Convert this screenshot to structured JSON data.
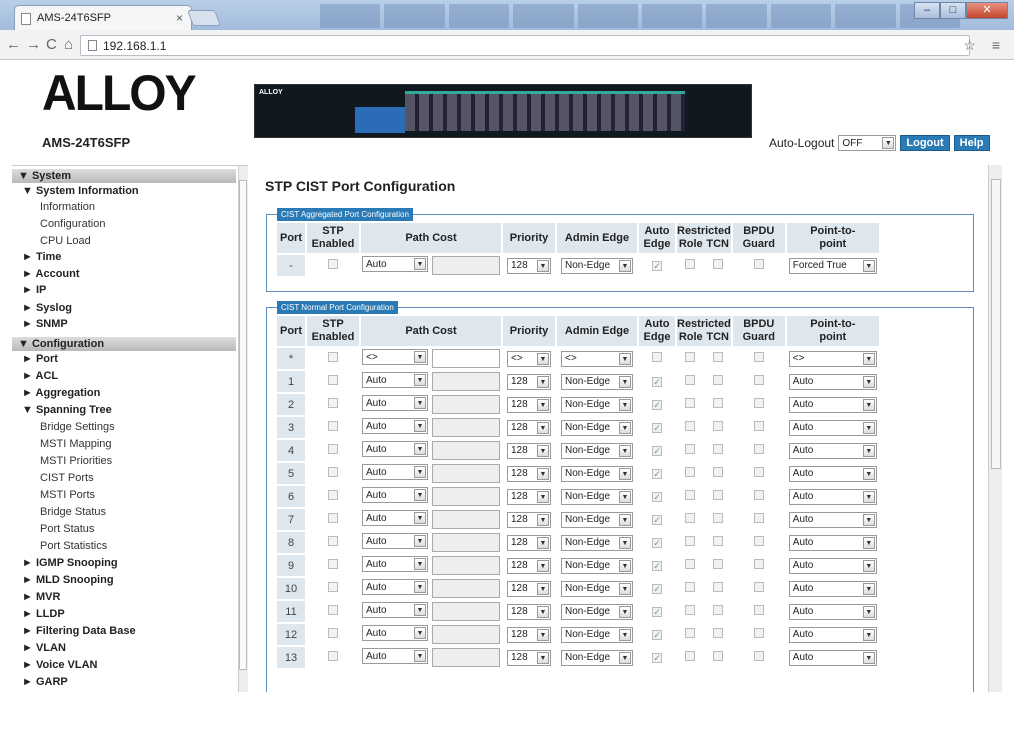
{
  "browser": {
    "tab_title": "AMS-24T6SFP",
    "url": "192.168.1.1"
  },
  "header": {
    "logo": "ALLOY",
    "model": "AMS-24T6SFP",
    "device_brand": "ALLOY",
    "auto_logout_label": "Auto-Logout",
    "auto_logout_value": "OFF",
    "logout_label": "Logout",
    "help_label": "Help"
  },
  "sidebar": [
    {
      "t": "▼ System",
      "lv": 0
    },
    {
      "t": "▼ System Information",
      "lv": 1
    },
    {
      "t": "Information",
      "lv": 2
    },
    {
      "t": "Configuration",
      "lv": 2
    },
    {
      "t": "CPU Load",
      "lv": 2
    },
    {
      "t": "► Time",
      "lv": 1
    },
    {
      "t": "► Account",
      "lv": 1
    },
    {
      "t": "► IP",
      "lv": 1
    },
    {
      "t": "► Syslog",
      "lv": 1
    },
    {
      "t": "► SNMP",
      "lv": 1
    },
    {
      "t": "▼ Configuration",
      "lv": 0
    },
    {
      "t": "► Port",
      "lv": 1
    },
    {
      "t": "► ACL",
      "lv": 1
    },
    {
      "t": "► Aggregation",
      "lv": 1
    },
    {
      "t": "▼ Spanning Tree",
      "lv": 1
    },
    {
      "t": "Bridge Settings",
      "lv": 2
    },
    {
      "t": "MSTI Mapping",
      "lv": 2
    },
    {
      "t": "MSTI Priorities",
      "lv": 2
    },
    {
      "t": "CIST Ports",
      "lv": 2
    },
    {
      "t": "MSTI Ports",
      "lv": 2
    },
    {
      "t": "Bridge Status",
      "lv": 2
    },
    {
      "t": "Port Status",
      "lv": 2
    },
    {
      "t": "Port Statistics",
      "lv": 2
    },
    {
      "t": "► IGMP Snooping",
      "lv": 1
    },
    {
      "t": "► MLD Snooping",
      "lv": 1
    },
    {
      "t": "► MVR",
      "lv": 1
    },
    {
      "t": "► LLDP",
      "lv": 1
    },
    {
      "t": "► Filtering Data Base",
      "lv": 1
    },
    {
      "t": "► VLAN",
      "lv": 1
    },
    {
      "t": "► Voice VLAN",
      "lv": 1
    },
    {
      "t": "► GARP",
      "lv": 1
    }
  ],
  "main": {
    "title": "STP CIST Port Configuration",
    "agg_legend": "CIST Aggregated Port Configuration",
    "normal_legend": "CIST Normal Port Configuration",
    "headers": {
      "port": "Port",
      "stp1": "STP",
      "stp2": "Enabled",
      "path_cost": "Path Cost",
      "priority": "Priority",
      "admin_edge": "Admin Edge",
      "auto1": "Auto",
      "auto2": "Edge",
      "restricted": "Restricted",
      "role": "Role",
      "tcn": "TCN",
      "bpdu1": "BPDU",
      "bpdu2": "Guard",
      "p2p1": "Point-to-",
      "p2p2": "point"
    },
    "agg_row": {
      "port": "-",
      "path_cost": "Auto",
      "priority": "128",
      "admin_edge": "Non-Edge",
      "auto_edge": true,
      "p2p": "Forced True"
    },
    "wildcard_row": {
      "port": "*",
      "path_cost": "<>",
      "priority": "<>",
      "admin_edge": "<>",
      "p2p": "<>"
    },
    "rows": [
      {
        "port": "1",
        "path_cost": "Auto",
        "priority": "128",
        "admin_edge": "Non-Edge",
        "auto_edge": true,
        "p2p": "Auto"
      },
      {
        "port": "2",
        "path_cost": "Auto",
        "priority": "128",
        "admin_edge": "Non-Edge",
        "auto_edge": true,
        "p2p": "Auto"
      },
      {
        "port": "3",
        "path_cost": "Auto",
        "priority": "128",
        "admin_edge": "Non-Edge",
        "auto_edge": true,
        "p2p": "Auto"
      },
      {
        "port": "4",
        "path_cost": "Auto",
        "priority": "128",
        "admin_edge": "Non-Edge",
        "auto_edge": true,
        "p2p": "Auto"
      },
      {
        "port": "5",
        "path_cost": "Auto",
        "priority": "128",
        "admin_edge": "Non-Edge",
        "auto_edge": true,
        "p2p": "Auto"
      },
      {
        "port": "6",
        "path_cost": "Auto",
        "priority": "128",
        "admin_edge": "Non-Edge",
        "auto_edge": true,
        "p2p": "Auto"
      },
      {
        "port": "7",
        "path_cost": "Auto",
        "priority": "128",
        "admin_edge": "Non-Edge",
        "auto_edge": true,
        "p2p": "Auto"
      },
      {
        "port": "8",
        "path_cost": "Auto",
        "priority": "128",
        "admin_edge": "Non-Edge",
        "auto_edge": true,
        "p2p": "Auto"
      },
      {
        "port": "9",
        "path_cost": "Auto",
        "priority": "128",
        "admin_edge": "Non-Edge",
        "auto_edge": true,
        "p2p": "Auto"
      },
      {
        "port": "10",
        "path_cost": "Auto",
        "priority": "128",
        "admin_edge": "Non-Edge",
        "auto_edge": true,
        "p2p": "Auto"
      },
      {
        "port": "11",
        "path_cost": "Auto",
        "priority": "128",
        "admin_edge": "Non-Edge",
        "auto_edge": true,
        "p2p": "Auto"
      },
      {
        "port": "12",
        "path_cost": "Auto",
        "priority": "128",
        "admin_edge": "Non-Edge",
        "auto_edge": true,
        "p2p": "Auto"
      },
      {
        "port": "13",
        "path_cost": "Auto",
        "priority": "128",
        "admin_edge": "Non-Edge",
        "auto_edge": true,
        "p2p": "Auto"
      }
    ]
  }
}
